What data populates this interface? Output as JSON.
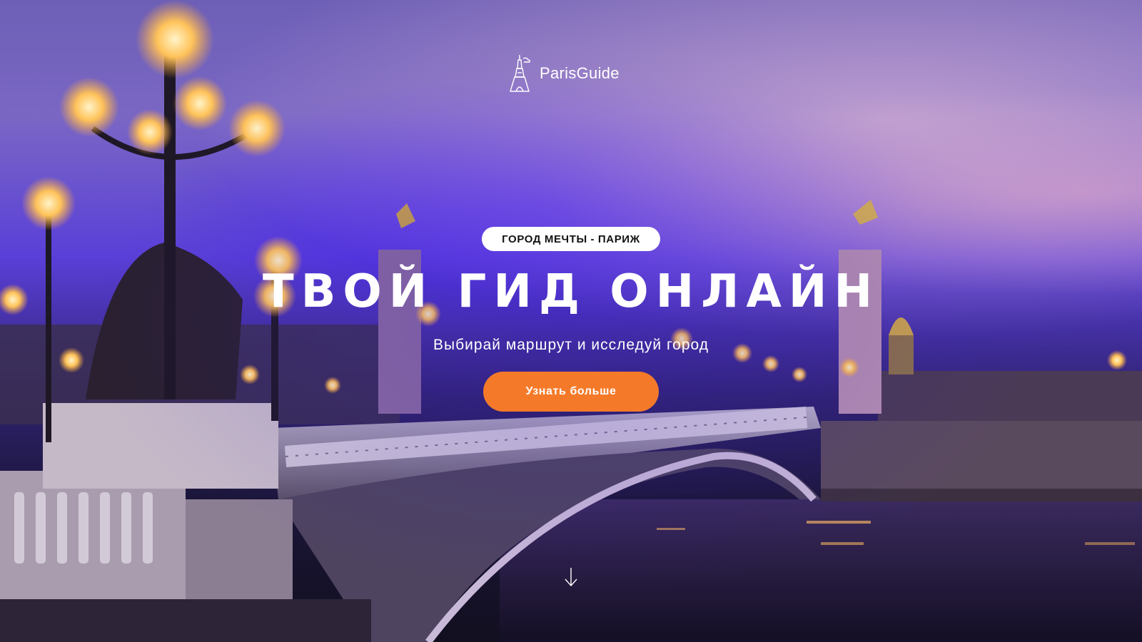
{
  "header": {
    "brand_name": "ParisGuide",
    "logo_icon": "eiffel-tower-icon"
  },
  "hero": {
    "badge": "ГОРОД МЕЧТЫ - ПАРИЖ",
    "headline": "ТВОЙ ГИД ОНЛАЙН",
    "subtitle": "Выбирай маршрут и исследуй город",
    "cta_label": "Узнать больше",
    "scroll_icon": "arrow-down-icon"
  },
  "colors": {
    "accent": "#f47a2a",
    "badge_bg": "#ffffff",
    "text": "#ffffff",
    "sky_purple": "#5a3fd8"
  }
}
